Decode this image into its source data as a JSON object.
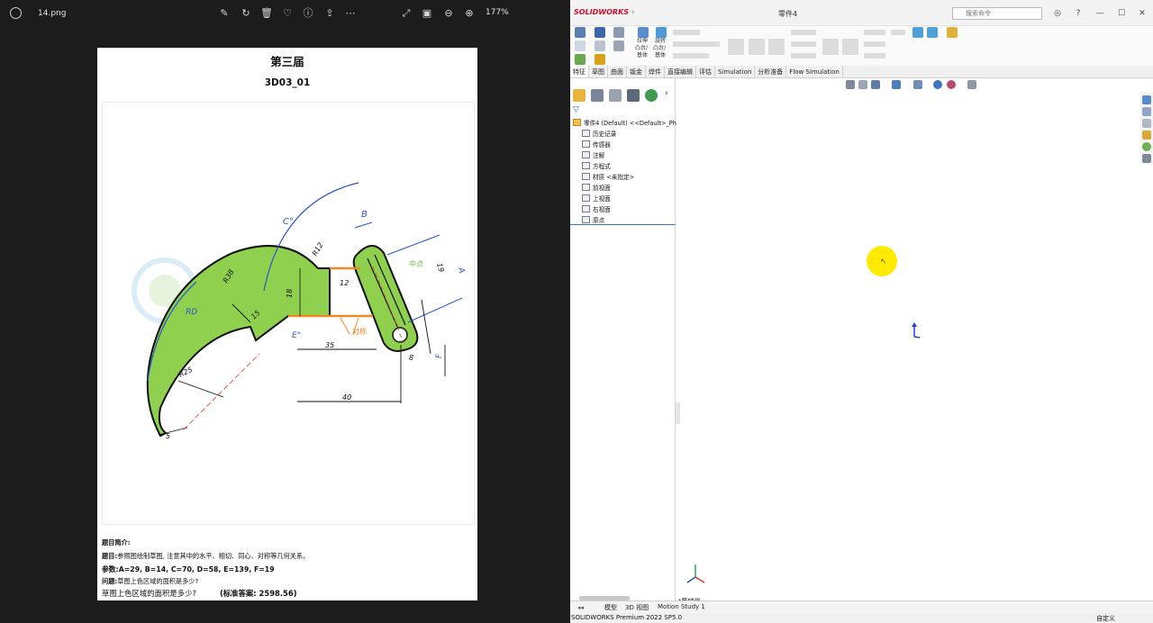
{
  "viewer": {
    "filename": "14.png",
    "zoom": "177%"
  },
  "document": {
    "title": "第三届",
    "code": "3D03_01",
    "intro_heading": "题目简介:",
    "topic_label": "题目:",
    "topic_text": "参照图绘制草图, 注意其中的水平、相切、同心、对称等几何关系。",
    "params_label": "参数:",
    "params_text": "A=29,  B=14,  C=70,  D=58,  E=139,  F=19",
    "question_label": "问题:",
    "question_text": "草图上色区域的面积是多少?",
    "question2_text": "草图上色区域的面积是多少?",
    "answer_text": "(标准答案: 2598.56)",
    "drawing_labels": {
      "c": "C°",
      "b": "B",
      "r12": "R12",
      "r38": "R38",
      "rd": "RD",
      "d19": "19",
      "d18": "18",
      "d12": "12",
      "d15": "15",
      "midpoint": "中点",
      "a": "A",
      "e": "E°",
      "d35": "35",
      "symmetric": "对称",
      "d8": "8",
      "f": "F",
      "r25": "R25",
      "d40": "40",
      "d5": "5"
    }
  },
  "sw": {
    "logo": "SOLIDWORKS",
    "doc_title": "零件4",
    "search_placeholder": "搜索命令",
    "ribbon": {
      "extrude_label_1": "拉伸",
      "extrude_label_2": "凸台/",
      "extrude_label_3": "基体",
      "revolve_label_1": "旋转",
      "revolve_label_2": "凸台/",
      "revolve_label_3": "基体"
    },
    "tabs": [
      "特征",
      "草图",
      "曲面",
      "钣金",
      "焊件",
      "直接编辑",
      "评估",
      "Simulation",
      "分析准备",
      "Flow Simulation"
    ],
    "tree": {
      "root": "零件4 (Default) <<Default>_Ph",
      "items": [
        "历史记录",
        "传感器",
        "注解",
        "方程式",
        "材质 <未指定>",
        "前视面",
        "上视面",
        "右视面",
        "原点"
      ]
    },
    "view_name": "*等轴测",
    "bottom_tabs": [
      "模型",
      "3D 视图",
      "Motion Study 1"
    ],
    "status_left": "SOLIDWORKS Premium 2022 SP5.0",
    "status_right": "自定义",
    "colors": {
      "accent_blue": "#3a78c2",
      "cursor_highlight": "#ffea00",
      "shape_fill": "#8fd14f",
      "brand_red": "#c8102e"
    }
  }
}
